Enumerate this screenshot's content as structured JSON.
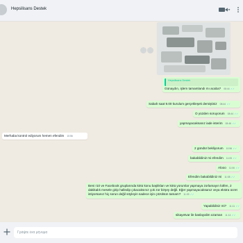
{
  "header": {
    "contact_name": "Hepsilisans Destek",
    "video_icon": "video-call-icon",
    "menu_icon": "menu-icon"
  },
  "image_message": {
    "content": "blurred-photo"
  },
  "messages": [
    {
      "id": "m1",
      "direction": "outgoing",
      "quote_author": "Hepsilisans Destek",
      "text": "Günaydın, işlem tamamlandı mı acaba?",
      "time": "08:44"
    },
    {
      "id": "m2",
      "direction": "outgoing",
      "text": "Sabah saat 9.00 kurulum gerçekleşek demiştiniz",
      "time": "08:44"
    },
    {
      "id": "m3",
      "direction": "outgoing",
      "text": "O yüzden soruyorum",
      "time": "08:44"
    },
    {
      "id": "m4",
      "direction": "outgoing",
      "text": "yapmayacaksanız iade isterim",
      "time": "08:46"
    },
    {
      "id": "m5",
      "direction": "incoming",
      "text": "Merhaba kontrol ediyorum hemen efendim",
      "time": "10:56"
    },
    {
      "id": "m6",
      "direction": "outgoing",
      "text": "2 gündür bekliyorum",
      "time": "10:56"
    },
    {
      "id": "m7",
      "direction": "outgoing",
      "text": "bakabildiniz mi efendim",
      "time": "11:05"
    },
    {
      "id": "m8",
      "direction": "outgoing",
      "text": "Alooo",
      "time": "11:06"
    },
    {
      "id": "m9",
      "direction": "outgoing",
      "text": "Efendim bakabildiniz mi",
      "time": "11:08"
    },
    {
      "id": "m10",
      "direction": "outgoing",
      "text": "Beni r10 ve Facebook gruplarında kötü konu başlıkları ve kötü yorumlar yapmaya zorlamayın lütfen, 2 dakikalık mesele girip halledip çıkacaksınız çok zor birşey değil. Eğer yapmayacaksanız veya ekstra ücret istiyorsanız hiç sorun değil söyleyin sadece işin çözülsün tamam?",
      "time": "11:09"
    },
    {
      "id": "m11",
      "direction": "outgoing",
      "text": "Yapabildiniz mi?",
      "time": "11:11"
    },
    {
      "id": "m12",
      "direction": "outgoing",
      "text": "sikayetvar ile baslayalim ozaman",
      "time": "11:14"
    }
  ],
  "composer": {
    "placeholder": "Γράψτε ένα μήνυμα",
    "plus_icon": "plus-icon"
  },
  "colors": {
    "outgoing_bubble": "#d9fdd3",
    "incoming_bubble": "#ffffff",
    "chat_background": "#efeae2",
    "quote_accent": "#06cf9c"
  }
}
